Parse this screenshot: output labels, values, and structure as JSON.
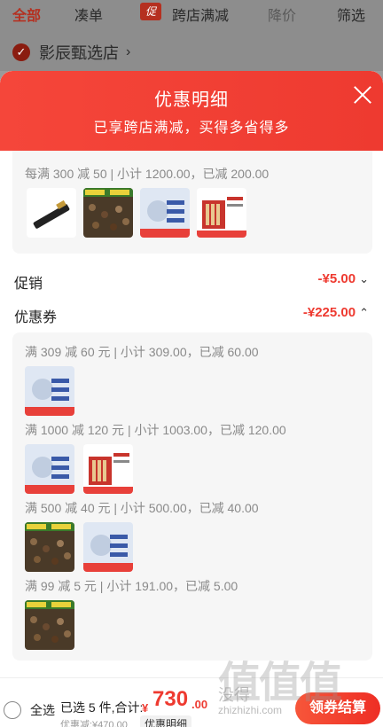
{
  "background": {
    "tabs": [
      "全部",
      "凑单",
      "促",
      "跨店满减",
      "降价",
      "筛选"
    ],
    "store_name": "影辰甄选店"
  },
  "sheet": {
    "title": "优惠明细",
    "subtitle": "已享跨店满减，买得多省得多"
  },
  "cross_store": {
    "label": "每满 300 减 50 | 小计 1200.00，已减 200.00"
  },
  "promo": {
    "label": "促销",
    "value": "-¥5.00"
  },
  "coupon": {
    "label": "优惠券",
    "value": "-¥225.00"
  },
  "coupon_groups": [
    {
      "label": "满 309 减 60 元 | 小计 309.00，已减 60.00"
    },
    {
      "label": "满 1000 减 120 元 | 小计 1003.00，已减 120.00"
    },
    {
      "label": "满 500 减 40 元 | 小计 500.00，已减 40.00"
    },
    {
      "label": "满 99 减 5 元 | 小计 191.00，已减 5.00"
    }
  ],
  "bottom": {
    "select_all": "全选",
    "summary": "已选 5 件,合计:",
    "yen": "¥",
    "total": "730",
    "total_decimal": ".00",
    "discount": "优惠减:¥470.00",
    "detail": "优惠明细",
    "checkout": "领券结算"
  },
  "watermark": {
    "big": "值值值",
    "small": "没得",
    "url": "zhizhizhi.com"
  },
  "colors": {
    "accent": "#ee3a30",
    "header": "#f5463a"
  }
}
